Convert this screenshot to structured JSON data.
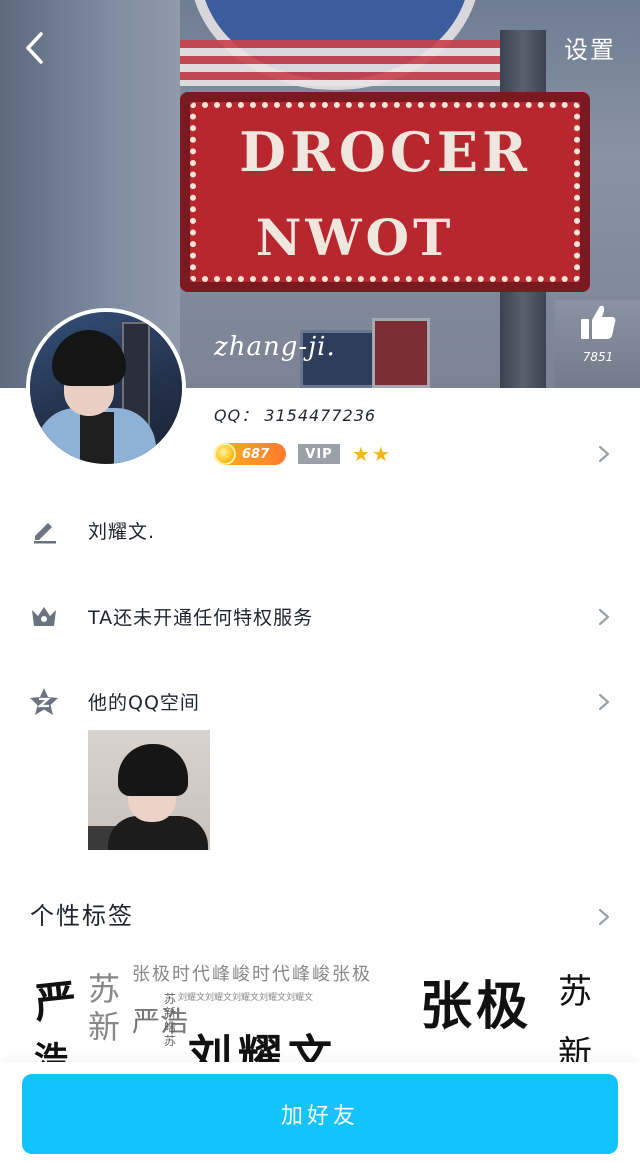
{
  "nav": {
    "settings_label": "设置"
  },
  "cover": {
    "sign_line1": "DROCER",
    "sign_line2": "NWOT"
  },
  "profile": {
    "nickname": "zhang-ji.",
    "qq_label": "QQ： 3154477236",
    "level_coins": "687",
    "vip_label": "VIP",
    "stars": [
      "★",
      "★"
    ],
    "like_count": "7851"
  },
  "rows": {
    "signature": "刘耀文.",
    "privilege": "TA还未开通任何特权服务",
    "qzone": "他的QQ空间"
  },
  "tags": {
    "title": "个性标签",
    "art": {
      "a": "严",
      "b": "苏",
      "c": "张极时代峰峻时代峰峻张极",
      "d": "刘耀文刘耀文刘耀文刘耀文刘耀文",
      "e": "新",
      "f": "严浩",
      "g": "苏新皓苏",
      "h": "刘耀文",
      "i": "张极",
      "j": "苏",
      "k": "新",
      "l": "浩"
    }
  },
  "bottom": {
    "add_friend_label": "加好友"
  },
  "colors": {
    "accent": "#12c4fb",
    "coin": "#ff9a1f",
    "star": "#f3b51b",
    "icon": "#6b7280"
  }
}
